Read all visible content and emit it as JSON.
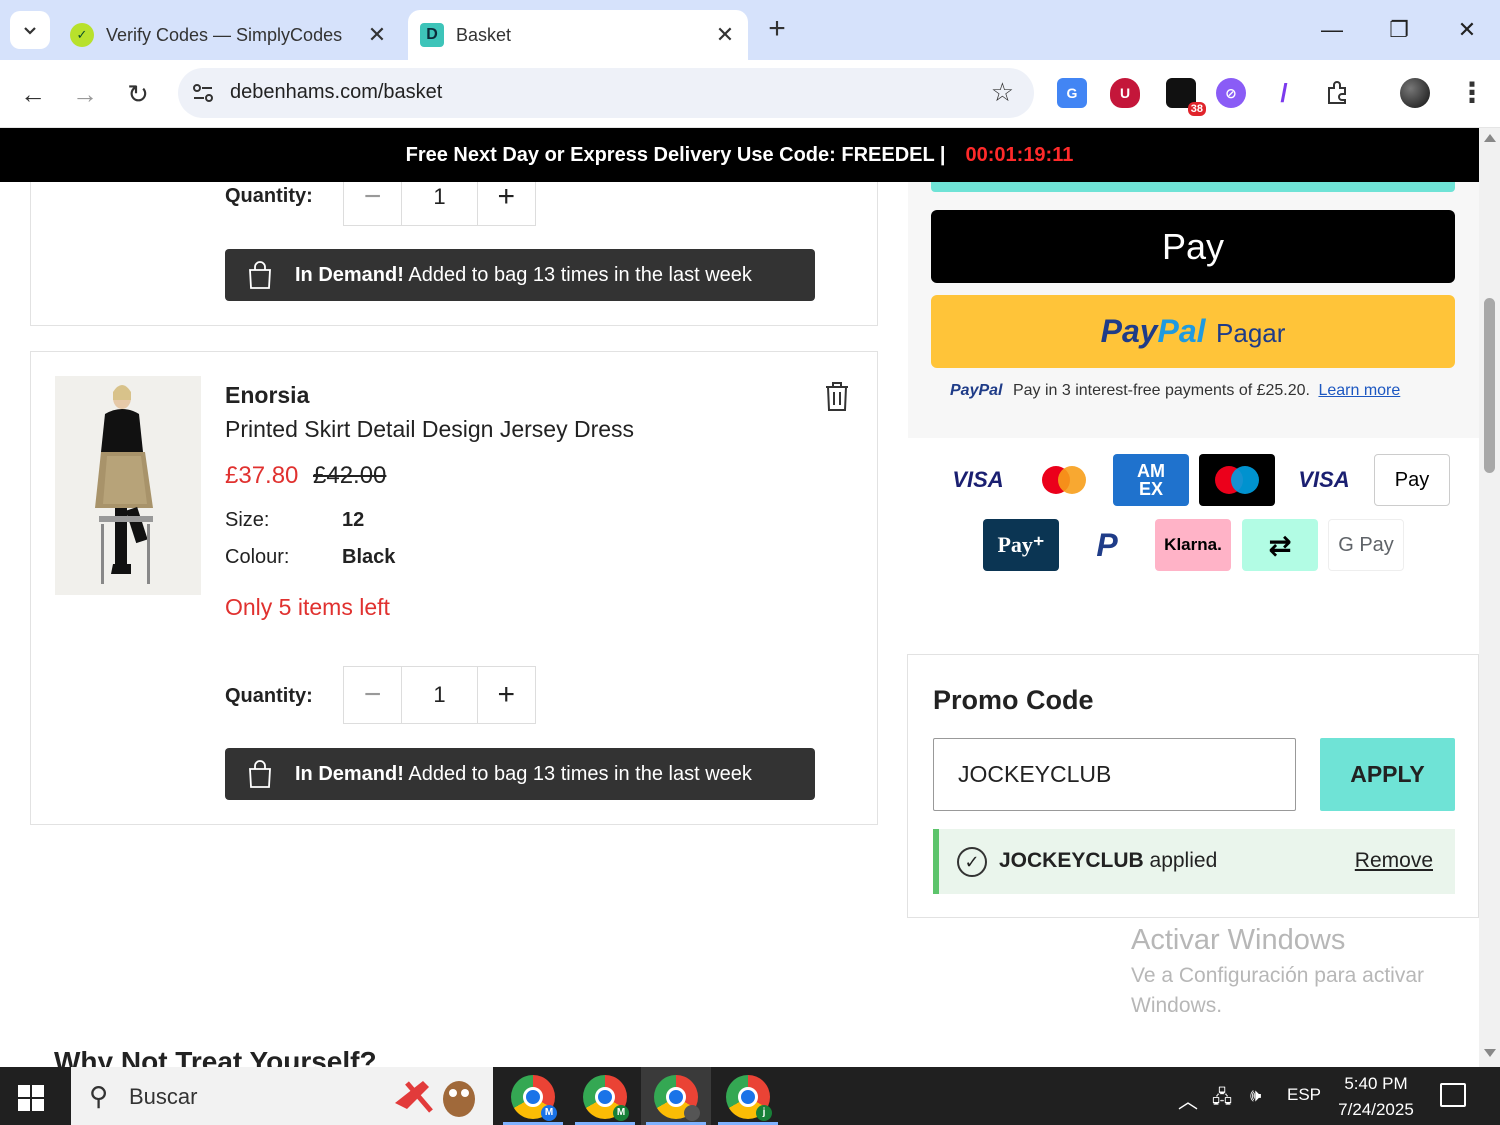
{
  "browser": {
    "tabs": [
      {
        "title": "Verify Codes — SimplyCodes",
        "favicon_label": "✓",
        "active": false
      },
      {
        "title": "Basket",
        "favicon_label": "D",
        "active": true
      }
    ],
    "url": "debenhams.com/basket",
    "extensions": [
      {
        "name": "translate-icon",
        "color": "#4285f4",
        "label": "G"
      },
      {
        "name": "ublock-icon",
        "color": "#c4163a",
        "label": "U"
      },
      {
        "name": "tab-counter-icon",
        "color": "#111111",
        "label": "",
        "badge": "38"
      },
      {
        "name": "vpn-icon",
        "color": "#8a5cf6",
        "label": "⊘"
      },
      {
        "name": "feather-icon",
        "color": "#7c3aed",
        "label": "/"
      },
      {
        "name": "puzzle-icon",
        "color": "#ffffff",
        "label": ""
      }
    ]
  },
  "banner": {
    "text": "Free Next Day or Express Delivery Use Code: FREEDEL |",
    "timer": "00:01:19:11"
  },
  "basket": {
    "item1": {
      "quantity_label": "Quantity:",
      "quantity": "1",
      "demand": {
        "strong": "In Demand!",
        "rest": " Added to bag 13 times in the last week"
      }
    },
    "item2": {
      "brand": "Enorsia",
      "name": "Printed Skirt Detail Design Jersey Dress",
      "price_now": "£37.80",
      "price_was": "£42.00",
      "size_label": "Size:",
      "size_value": "12",
      "colour_label": "Colour:",
      "colour_value": "Black",
      "stock_note": "Only 5 items left",
      "quantity_label": "Quantity:",
      "quantity": "1",
      "demand": {
        "strong": "In Demand!",
        "rest": " Added to bag 13 times in the last week"
      }
    },
    "recommendations_title": "Why Not Treat Yourself?"
  },
  "checkout": {
    "applepay_label": "Pay",
    "paypal": {
      "brand1": "Pay",
      "brand2": "Pal",
      "cta": "Pagar"
    },
    "paypal_note": {
      "brand": "PayPal",
      "text": "Pay in 3 interest-free payments of £25.20.",
      "link": "Learn more"
    },
    "payment_methods": [
      {
        "name": "visa-logo",
        "label": "VISA",
        "bg": "#ffffff",
        "fg": "#1a1f71"
      },
      {
        "name": "mastercard-logo",
        "label": "",
        "bg": "#ffffff",
        "fg": "#000000"
      },
      {
        "name": "amex-logo",
        "label": "AM EX",
        "bg": "#1f72cd",
        "fg": "#ffffff"
      },
      {
        "name": "maestro-logo",
        "label": "",
        "bg": "#000000",
        "fg": "#ffffff"
      },
      {
        "name": "visa-electron-logo",
        "label": "VISA",
        "bg": "#ffffff",
        "fg": "#1a1f71"
      },
      {
        "name": "apple-pay-logo",
        "label": "Pay",
        "bg": "#ffffff",
        "fg": "#000000"
      },
      {
        "name": "payplus-logo",
        "label": "Pay⁺",
        "bg": "#0b3553",
        "fg": "#ffffff"
      },
      {
        "name": "paypal-logo",
        "label": "P",
        "bg": "#ffffff",
        "fg": "#1f3c88"
      },
      {
        "name": "klarna-logo",
        "label": "Klarna.",
        "bg": "#ffb3c7",
        "fg": "#000000"
      },
      {
        "name": "clearpay-logo",
        "label": "⇄",
        "bg": "#b2fce4",
        "fg": "#000000"
      },
      {
        "name": "google-pay-logo",
        "label": "G Pay",
        "bg": "#ffffff",
        "fg": "#5f6368"
      }
    ]
  },
  "promo": {
    "title": "Promo Code",
    "input_value": "JOCKEYCLUB",
    "apply_label": "APPLY",
    "applied_code": "JOCKEYCLUB",
    "applied_suffix": " applied",
    "remove_label": "Remove"
  },
  "watermark": {
    "title": "Activar Windows",
    "subtitle": "Ve a Configuración para activar Windows."
  },
  "taskbar": {
    "search_placeholder": "Buscar",
    "apps": [
      {
        "name": "chrome-profile-m1",
        "badge": "M",
        "badge_color": "#1a73e8"
      },
      {
        "name": "chrome-profile-m2",
        "badge": "M",
        "badge_color": "#188038"
      },
      {
        "name": "chrome-profile-active",
        "badge": "",
        "badge_color": "#555555"
      },
      {
        "name": "chrome-profile-j",
        "badge": "j",
        "badge_color": "#188038"
      }
    ],
    "language": "ESP",
    "time": "5:40 PM",
    "date": "7/24/2025"
  }
}
